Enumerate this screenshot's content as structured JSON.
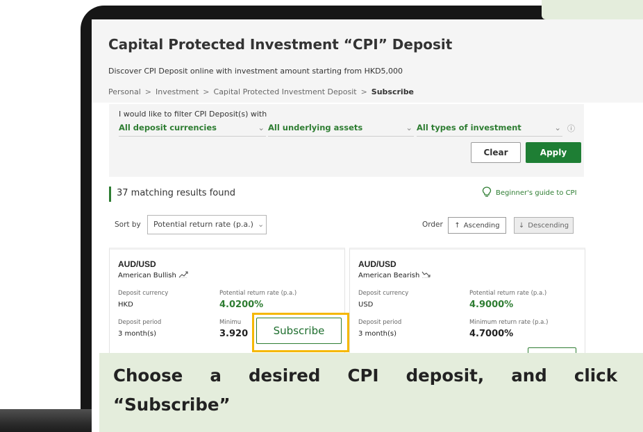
{
  "page": {
    "title": "Capital Protected Investment “CPI” Deposit",
    "subtitle": "Discover CPI Deposit online with investment amount starting from HKD5,000"
  },
  "breadcrumb": [
    "Personal",
    "Investment",
    "Capital Protected Investment Deposit",
    "Subscribe"
  ],
  "filter": {
    "intro": "I would like to filter CPI Deposit(s) with",
    "currency": "All deposit currencies",
    "assets": "All underlying assets",
    "types": "All types of investment",
    "clear_label": "Clear",
    "apply_label": "Apply"
  },
  "results": {
    "count_text": "37 matching results found",
    "guide_link": "Beginner's guide to CPI"
  },
  "sort": {
    "label": "Sort by",
    "value": "Potential return rate (p.a.)",
    "order_label": "Order",
    "ascending": "Ascending",
    "descending": "Descending"
  },
  "cards": [
    {
      "pair": "AUD/USD",
      "type": "American Bullish",
      "currency_label": "Deposit currency",
      "currency": "HKD",
      "potential_label": "Potential return rate (p.a.)",
      "potential": "4.0200%",
      "period_label": "Deposit period",
      "period": "3 month(s)",
      "min_label": "Minimu",
      "min": "3.920"
    },
    {
      "pair": "AUD/USD",
      "type": "American Bearish",
      "currency_label": "Deposit currency",
      "currency": "USD",
      "potential_label": "Potential return rate (p.a.)",
      "potential": "4.9000%",
      "period_label": "Deposit period",
      "period": "3 month(s)",
      "min_label": "Minimum return rate (p.a.)",
      "min": "4.7000%"
    }
  ],
  "subscribe_label": "Subscribe",
  "caption": {
    "line1": "Choose a desired CPI deposit, and click",
    "line2": "“Subscribe”"
  },
  "colors": {
    "accent_green": "#2e7d32",
    "highlight_yellow": "#f5b800",
    "caption_bg": "#e4eddc"
  }
}
